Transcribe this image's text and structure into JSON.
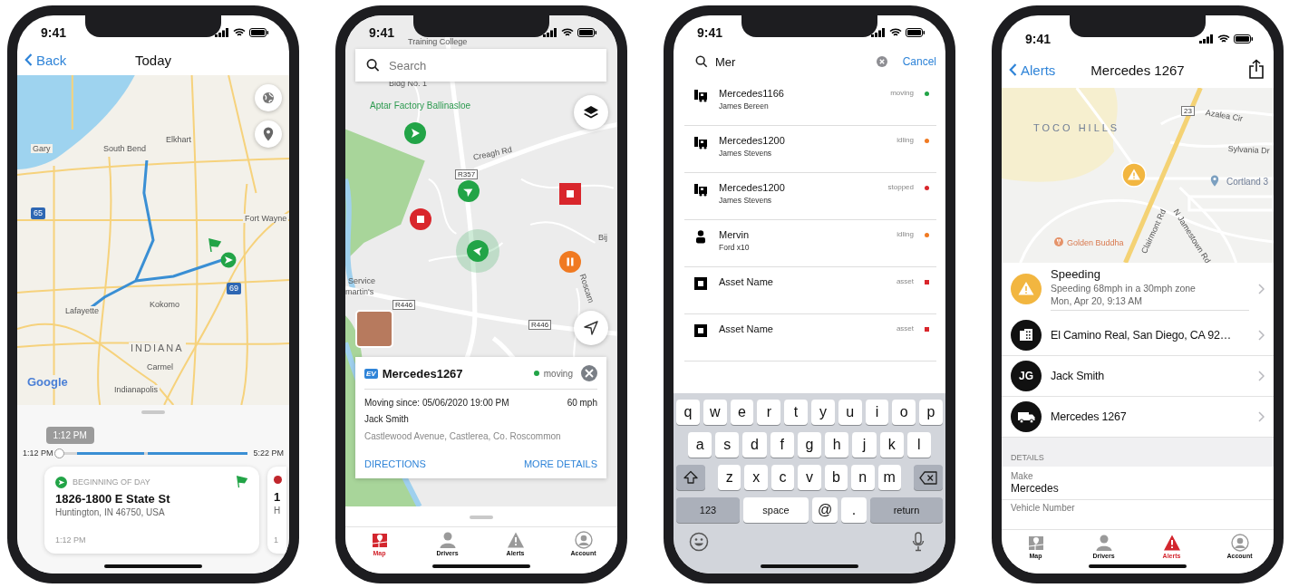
{
  "trip_screen": {
    "status_time": "9:41",
    "back": "Back",
    "title": "Today",
    "map_labels": [
      "Gary",
      "South Bend",
      "Elkhart",
      "Fort Wayne",
      "Kokomo",
      "Lafayette",
      "INDIANA",
      "Carmel",
      "Indianapolis",
      "65",
      "69",
      "Google"
    ],
    "timeline": {
      "tooltip": "1:12 PM",
      "start": "1:12 PM",
      "end": "5:22 PM",
      "level": 0
    },
    "stops": [
      {
        "kind": "start",
        "label": "BEGINNING OF DAY",
        "title": "1826-1800 E State St",
        "address": "Huntington, IN 46750, USA",
        "time": "1:12 PM"
      },
      {
        "kind": "stop",
        "title": "1",
        "address": "H",
        "time": "1"
      }
    ]
  },
  "map_screen": {
    "status_time": "9:41",
    "search_placeholder": "Search",
    "map_labels": [
      "Training College",
      "Bldg No. 1",
      "Aptar Factory Ballinasloe",
      "Creagh Rd",
      "R357",
      "Bij",
      "Service",
      "martin's",
      "R446",
      "R446",
      "Roscam"
    ],
    "markers": [
      {
        "kind": "moving",
        "selected": false
      },
      {
        "kind": "moving",
        "selected": false
      },
      {
        "kind": "stopped",
        "selected": false
      },
      {
        "kind": "moving",
        "selected": true
      },
      {
        "kind": "asset",
        "selected": false
      },
      {
        "kind": "idling",
        "selected": false
      }
    ],
    "vehicle": {
      "badge": "EV",
      "name": "Mercedes1267",
      "status": "moving",
      "color": "#22a447",
      "since": "Moving since: 05/06/2020 19:00 PM",
      "speed": "60 mph",
      "driver": "Jack Smith",
      "address": "Castlewood Avenue, Castlerea, Co. Roscommon",
      "actions": [
        "DIRECTIONS",
        "MORE DETAILS"
      ]
    },
    "tabs": [
      {
        "kind": "map",
        "label": "Map",
        "selected": true
      },
      {
        "kind": "drivers",
        "label": "Drivers",
        "selected": false
      },
      {
        "kind": "alerts",
        "label": "Alerts",
        "selected": false
      },
      {
        "kind": "account",
        "label": "Account",
        "selected": false
      }
    ]
  },
  "search_screen": {
    "status_time": "9:41",
    "query": "Mer",
    "cancel": "Cancel",
    "results": [
      {
        "kind": "vehicle",
        "name": "Mercedes1166",
        "detail": "James Bereen",
        "status": "moving",
        "color": "#22a447"
      },
      {
        "kind": "vehicle",
        "name": "Mercedes1200",
        "detail": "James Stevens",
        "status": "idling",
        "color": "#f07a22"
      },
      {
        "kind": "vehicle",
        "name": "Mercedes1200",
        "detail": "James Stevens",
        "status": "stopped",
        "color": "#d9262c"
      },
      {
        "kind": "driver",
        "name": "Mervin",
        "detail": "Ford x10",
        "status": "idling",
        "color": "#f07a22"
      },
      {
        "kind": "asset",
        "name": "Asset Name",
        "status": "asset",
        "color": "#d9262c"
      },
      {
        "kind": "asset",
        "name": "Asset Name",
        "status": "asset",
        "color": "#d9262c"
      }
    ],
    "keyboard": {
      "rows": [
        [
          "q",
          "w",
          "e",
          "r",
          "t",
          "y",
          "u",
          "i",
          "o",
          "p"
        ],
        [
          "a",
          "s",
          "d",
          "f",
          "g",
          "h",
          "j",
          "k",
          "l"
        ],
        [
          "z",
          "x",
          "c",
          "v",
          "b",
          "n",
          "m"
        ]
      ],
      "bottom": [
        {
          "kind": "mode",
          "label": "123"
        },
        {
          "kind": "space",
          "label": "space"
        },
        {
          "kind": "char",
          "label": "@"
        },
        {
          "kind": "char",
          "label": "."
        },
        {
          "kind": "return",
          "label": "return"
        }
      ]
    }
  },
  "alert_screen": {
    "status_time": "9:41",
    "back": "Alerts",
    "title": "Mercedes 1267",
    "map_labels": [
      "TOCO HILLS",
      "23",
      "Azalea Cir",
      "Sylvania Dr",
      "Cortland 3",
      "Clairmont Rd",
      "N Jamestown Rd",
      "Golden Buddha"
    ],
    "alert": {
      "title": "Speeding",
      "description": "Speeding 68mph in a 30mph zone",
      "time": "Mon, Apr 20, 9:13 AM"
    },
    "links": [
      {
        "kind": "place",
        "text": "El Camino Real, San Diego, CA 92…"
      },
      {
        "kind": "driver",
        "initials": "JG",
        "text": "Jack Smith"
      },
      {
        "kind": "vehicle",
        "text": "Mercedes 1267"
      }
    ],
    "details_header": "DETAILS",
    "details": [
      {
        "label": "Make",
        "value": "Mercedes"
      },
      {
        "label": "Vehicle Number"
      }
    ],
    "tabs": [
      {
        "kind": "map",
        "label": "Map",
        "selected": false
      },
      {
        "kind": "drivers",
        "label": "Drivers",
        "selected": false
      },
      {
        "kind": "alerts",
        "label": "Alerts",
        "selected": true
      },
      {
        "kind": "account",
        "label": "Account",
        "selected": false
      }
    ]
  }
}
